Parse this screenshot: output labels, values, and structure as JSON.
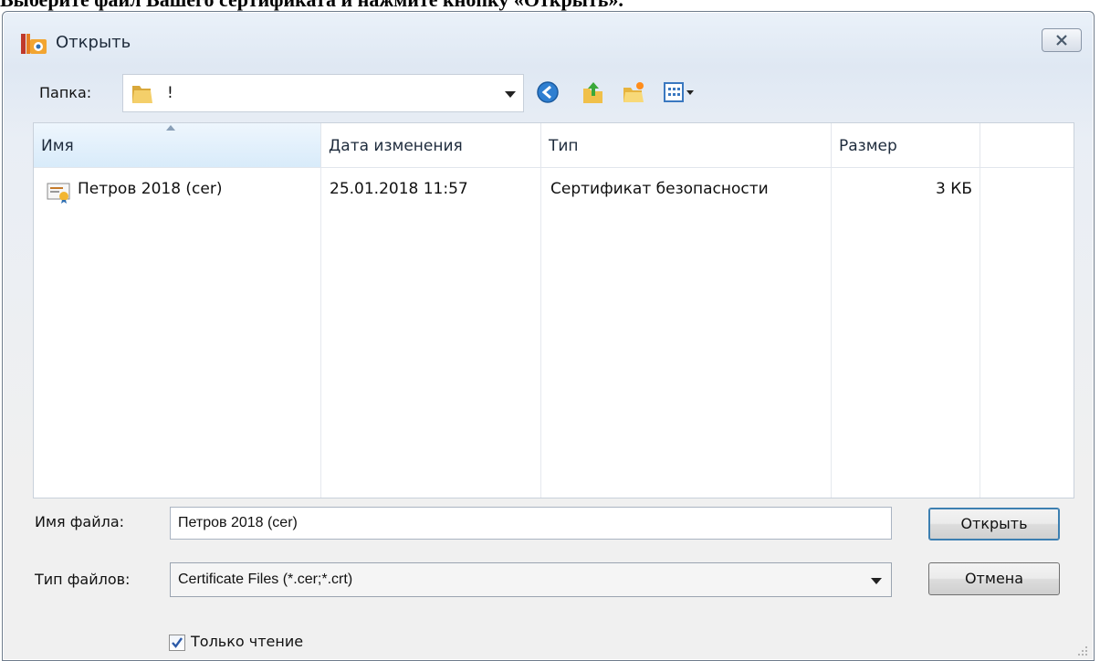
{
  "caption": "Выберите файл Вашего сертификата и нажмите кнопку «Открыть».",
  "window": {
    "title": "Открыть",
    "close_icon": "close-icon"
  },
  "toolbar": {
    "folder_label": "Папка:",
    "folder_value": "!",
    "buttons": [
      "back-icon",
      "up-folder-icon",
      "new-folder-icon",
      "view-menu-icon"
    ]
  },
  "file_list": {
    "columns": [
      "Имя",
      "Дата изменения",
      "Тип",
      "Размер"
    ],
    "rows": [
      {
        "name": "Петров 2018 (cer)",
        "date": "25.01.2018 11:57",
        "type": "Сертификат безопасности",
        "size": "3 КБ"
      }
    ]
  },
  "form": {
    "filename_label": "Имя файла:",
    "filename_value": "Петров 2018 (cer)",
    "filetype_label": "Тип файлов:",
    "filetype_value": "Certificate Files (*.cer;*.crt)",
    "open_button": "Открыть",
    "cancel_button": "Отмена",
    "readonly_label": "Только чтение",
    "readonly_checked": true
  },
  "colors": {
    "accent": "#3c7fb1",
    "header_sorted": "#d8ebfa"
  }
}
